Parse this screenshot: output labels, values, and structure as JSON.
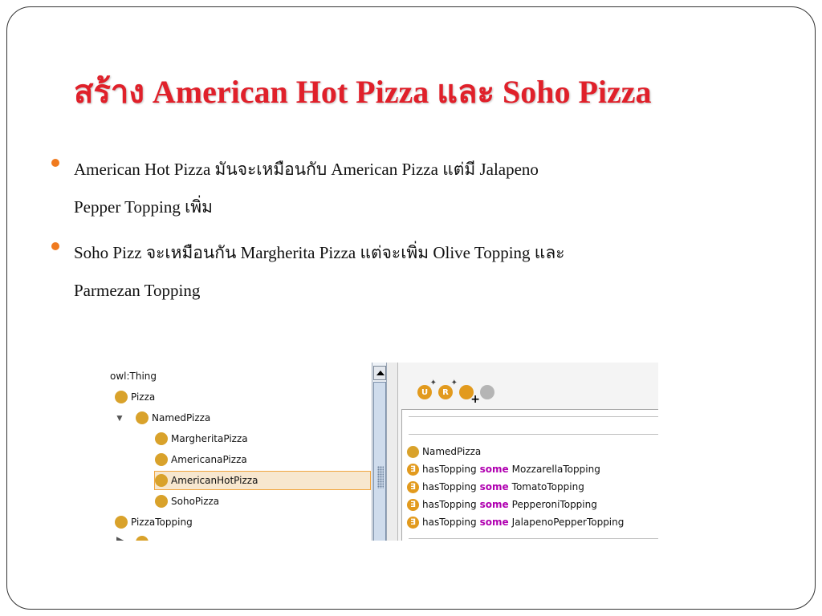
{
  "slide": {
    "title": "สร้าง American Hot Pizza และ Soho Pizza",
    "bullets": [
      {
        "lines": [
          "American Hot Pizza มันจะเหมือนกับ American Pizza  แต่มี Jalapeno",
          "Pepper Topping เพิ่ม"
        ]
      },
      {
        "lines": [
          "Soho Pizz จะเหมือนกัน Margherita Pizza แต่จะเพิ่ม Olive Topping และ",
          "Parmezan Topping"
        ]
      }
    ],
    "colors": {
      "title": "#e0202a",
      "bullet": "#f07a1e",
      "class_icon": "#d9a22b",
      "keyword": "#b000b0"
    }
  },
  "screenshot": {
    "tree": {
      "root": "owl:Thing",
      "items": [
        {
          "label": "Pizza"
        },
        {
          "label": "NamedPizza",
          "expanded": true
        },
        {
          "label": "MargheritaPizza"
        },
        {
          "label": "AmericanaPizza"
        },
        {
          "label": "AmericanHotPizza",
          "selected": true
        },
        {
          "label": "SohoPizza"
        },
        {
          "label": "PizzaTopping"
        }
      ],
      "expander_open": "▼",
      "expander_closed": "▶"
    },
    "toolbar_icons": [
      {
        "name": "add-subclass-icon",
        "glyph": "U"
      },
      {
        "name": "add-sibling-icon",
        "glyph": "R"
      },
      {
        "name": "add-class-icon",
        "glyph": ""
      },
      {
        "name": "delete-class-icon",
        "glyph": ""
      }
    ],
    "description": {
      "superclass": "NamedPizza",
      "icon_glyph": "∃",
      "restrictions": [
        {
          "property": "hasTopping",
          "keyword": "some",
          "filler": "MozzarellaTopping"
        },
        {
          "property": "hasTopping",
          "keyword": "some",
          "filler": "TomatoTopping"
        },
        {
          "property": "hasTopping",
          "keyword": "some",
          "filler": "PepperoniTopping"
        },
        {
          "property": "hasTopping",
          "keyword": "some",
          "filler": "JalapenoPepperTopping"
        }
      ]
    }
  }
}
